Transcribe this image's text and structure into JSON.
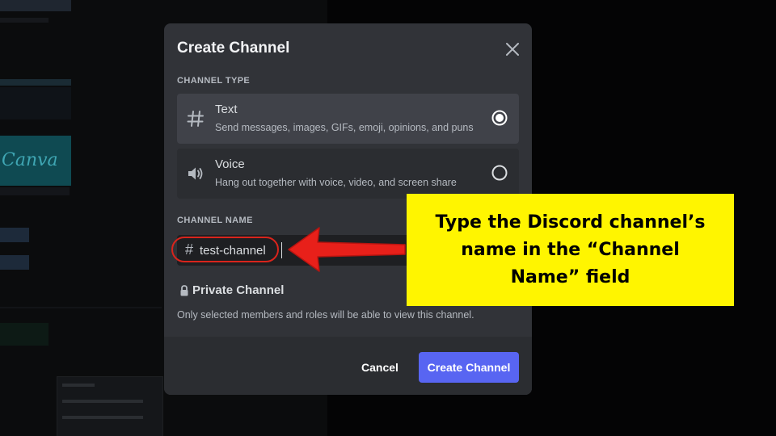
{
  "modal": {
    "title": "Create Channel",
    "close_icon": "close-icon",
    "channel_type_label": "CHANNEL TYPE",
    "types": [
      {
        "icon": "hash-icon",
        "name": "Text",
        "description": "Send messages, images, GIFs, emoji, opinions, and puns",
        "selected": true
      },
      {
        "icon": "speaker-icon",
        "name": "Voice",
        "description": "Hang out together with voice, video, and screen share",
        "selected": false
      }
    ],
    "channel_name_label": "CHANNEL NAME",
    "channel_name_prefix": "#",
    "channel_name_value": "test-channel",
    "private_icon": "lock-icon",
    "private_label": "Private Channel",
    "private_description": "Only selected members and roles will be able to view this channel.",
    "cancel_label": "Cancel",
    "create_label": "Create Channel"
  },
  "background": {
    "canva_text": "Canva"
  },
  "annotation": {
    "text": "Type the Discord channel’s name in the “Channel Name” field",
    "highlight_color": "#fff500",
    "marker_color": "#d9241c"
  },
  "colors": {
    "modal_bg": "#313338",
    "footer_bg": "#2b2d31",
    "selected_option_bg": "#404249",
    "input_bg": "#1e1f22",
    "primary_button": "#5865f2"
  }
}
